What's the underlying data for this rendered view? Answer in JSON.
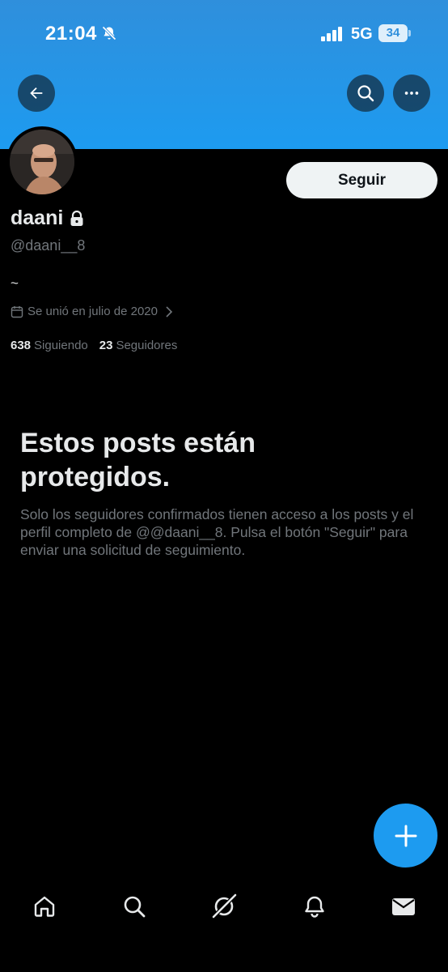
{
  "status": {
    "time": "21:04",
    "network": "5G",
    "battery": "34"
  },
  "nav": {
    "back_icon": "arrow-left-icon",
    "search_icon": "search-icon",
    "more_icon": "more-horizontal-icon"
  },
  "profile": {
    "display_name": "daani",
    "handle": "@daani__8",
    "bio": "~",
    "joined": "Se unió en julio de 2020",
    "following_count": "638",
    "following_label": "Siguiendo",
    "followers_count": "23",
    "followers_label": "Seguidores",
    "follow_label": "Seguir"
  },
  "protected": {
    "title": "Estos posts están protegidos.",
    "description": "Solo los seguidores confirmados tienen acceso a los posts y el perfil completo de @@daani__8. Pulsa el botón \"Seguir\" para enviar una solicitud de seguimiento."
  },
  "tabbar": {
    "items": [
      "home-icon",
      "search-icon",
      "grok-icon",
      "notifications-icon",
      "messages-icon"
    ]
  },
  "colors": {
    "accent": "#1d9bf0",
    "background": "#000000",
    "text": "#e7e9ea",
    "muted": "#71767b"
  }
}
